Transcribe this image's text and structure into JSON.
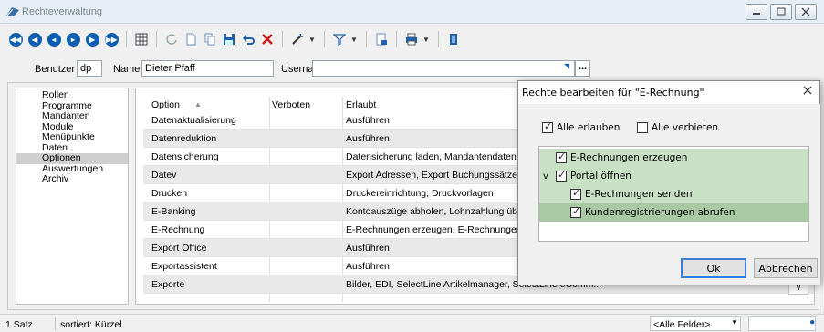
{
  "window": {
    "title": "Rechteverwaltung"
  },
  "userbar": {
    "benutzer_label": "Benutzer",
    "benutzer_value": "dp",
    "name_label": "Name",
    "name_value": "Dieter Pfaff",
    "username_label": "Username",
    "username_value": "",
    "lookup_label": "..."
  },
  "sidebar": {
    "items": [
      "Rollen",
      "Programme",
      "Mandanten",
      "Module",
      "Menüpunkte",
      "Daten",
      "Optionen",
      "Auswertungen",
      "Archiv"
    ],
    "selected": "Optionen"
  },
  "grid": {
    "columns": [
      "Option",
      "Verboten",
      "Erlaubt"
    ],
    "sort_indicator": "▲",
    "rows": [
      {
        "option": "Datenaktualisierung",
        "verboten": "",
        "erlaubt": "Ausführen"
      },
      {
        "option": "Datenreduktion",
        "verboten": "",
        "erlaubt": "Ausführen"
      },
      {
        "option": "Datensicherung",
        "verboten": "",
        "erlaubt": "Datensicherung laden, Mandantendaten s"
      },
      {
        "option": "Datev",
        "verboten": "",
        "erlaubt": "Export Adressen, Export Buchungssätze, E"
      },
      {
        "option": "Drucken",
        "verboten": "",
        "erlaubt": "Druckereinrichtung, Druckvorlagen"
      },
      {
        "option": "E-Banking",
        "verboten": "",
        "erlaubt": "Kontoauszüge abholen, Lohnzahlung über"
      },
      {
        "option": "E-Rechnung",
        "verboten": "",
        "erlaubt": "E-Rechnungen erzeugen, E-Rechnungen"
      },
      {
        "option": "Export Office",
        "verboten": "",
        "erlaubt": "Ausführen"
      },
      {
        "option": "Exportassistent",
        "verboten": "",
        "erlaubt": "Ausführen"
      },
      {
        "option": "Exporte",
        "verboten": "",
        "erlaubt": "Bilder, EDI, SelectLine Artikelmanager, SelectLine eComm..."
      }
    ]
  },
  "statusbar": {
    "count": "1 Satz",
    "sort": "sortiert: Kürzel",
    "field_filter": "<Alle Felder>"
  },
  "dialog": {
    "title": "Rechte bearbeiten für \"E-Rechnung\"",
    "allow_all": "Alle erlauben",
    "deny_all": "Alle verbieten",
    "tree": [
      {
        "label": "E-Rechnungen erzeugen",
        "checked": true,
        "indent": 0,
        "expander": ""
      },
      {
        "label": "Portal öffnen",
        "checked": true,
        "indent": 0,
        "expander": "v"
      },
      {
        "label": "E-Rechnungen senden",
        "checked": true,
        "indent": 1,
        "expander": ""
      },
      {
        "label": "Kundenregistrierungen abrufen",
        "checked": true,
        "indent": 1,
        "expander": ""
      }
    ],
    "ok": "Ok",
    "cancel": "Abbrechen",
    "colors": {
      "tree_row": "#c8e0c4",
      "tree_row_selected": "#a9c8a4"
    }
  }
}
